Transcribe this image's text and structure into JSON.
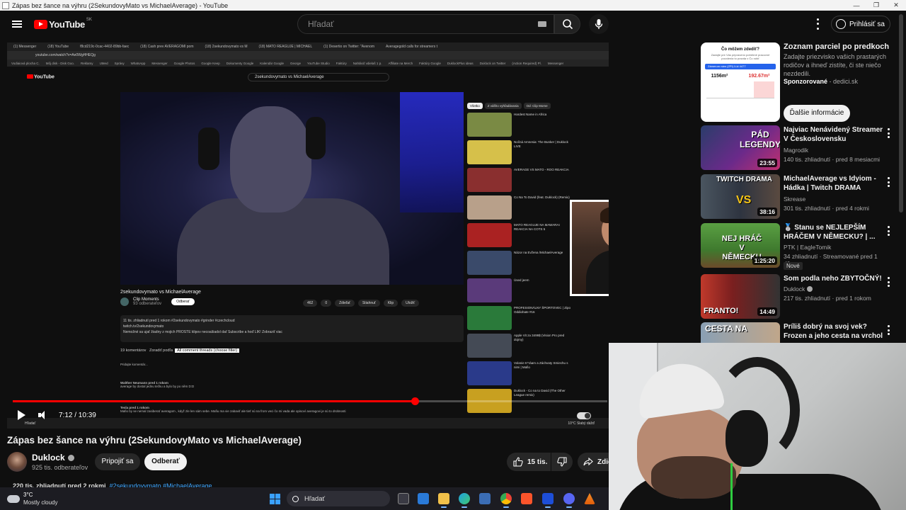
{
  "window": {
    "title": "Zápas bez šance na výhru (2SekundovyMato vs MichaelAverage) - YouTube"
  },
  "header": {
    "logo_text": "YouTube",
    "country": "SK",
    "search_placeholder": "Hľadať",
    "signin_label": "Prihlásiť sa"
  },
  "player": {
    "time": "7:12 / 10:39",
    "progress": 0.676,
    "inner": {
      "tabs": [
        "(1) Messenger",
        "(18) YouTube",
        "f8cd219c-0cac-4402-89bb-faec",
        "(18) Cash prev AVERAGOMI pom",
        "(18) 2sekundovymato vs M",
        "(18) MATO REAGUJE | MICHAEL",
        "(1) Desertio on Twitter: \"Avenom",
        "Averagegold calls for streamers t"
      ],
      "url": "youtube.com/watch?v=Ae0WgHHEQg",
      "bookmarks": [
        "Vodiaiová plocha C.",
        "Môj disk - Disk Goo.",
        "Reklamy",
        "UMed",
        "Správy",
        "WhatsApp",
        "Messenger",
        "Google Photos",
        "Google Keep",
        "Dokumenty Google",
        "Kalendár Google",
        "George",
        "YouTube Studio",
        "Faktúry",
        "Nahlásiť vdielaš 1 p.",
        "Affiliate na Merch",
        "Faktúry Google",
        "DuklockPlus ideas",
        "Duklock on Twitter",
        "(Action Required) Pl.",
        "Messenger"
      ],
      "logo": "YouTube",
      "search_value": "2sekundovymato vs MichaelAverage",
      "video_title": "2sekundovymato vs MichaelAverage",
      "channel": "Clip Moments",
      "channel_subs": "93 odberateľov",
      "subscribe": "Odberať",
      "actions": [
        "462",
        "0",
        "Zdieľať",
        "Stiahnuť",
        "Klip",
        "Uložiť"
      ],
      "desc_line1": "11 tis. zhliadnutí pred 1 rokom #2sekundovymato #grinder #czechcloud",
      "desc_line2": "twitch.tv/2sekundovymato",
      "desc_line3": "Nemožné sa ujať žiadny z mojich PROSTE klipov necoašiadol dať Subscribe a hoď LIK! Zobraziť viac",
      "comments_count": "19 komentárov",
      "sort_label": "Zoradiť podľa",
      "filter_label": "All comment threads (choose filter)",
      "add_comment": "Pridajte komentár...",
      "comment1_author": "Walther Neumann  pred 1 rokom",
      "comment1_text": "average by dostal jednu tečku a bylo by po něm D:D",
      "comment2_author": "Tesla  pred 1 rokom",
      "comment2_text": "Mafio by se nemal zasiberať averagom , když zle len sám sebe. Mafiu ma vie zabaviť ale tieť sú na from veci čo mi vada ale opisoví averagovi je sú to drobnosti",
      "taskbar_search": "Hľadať",
      "weather_inner": "10°C  Slabý dážď",
      "related_chips": [
        "Všetko",
        "Z vášho vyhľadávania",
        "Od: Clip Mome"
      ],
      "related": [
        "Hardest Name in Africa",
        "Nočná Amnesia: The Bunker | Duklock LIVE",
        "AVERAGE VS MATO - ROO REAKCIA",
        "Co Na To David (feat. Duklock) (Remix)",
        "MATO REAGUJE NA MAWARAI REAKCIA NA COTS 5",
        "Názor na Evžena /MichaelAverage",
        "Úsed jeem",
        "PROFESIONÁLNY ŠPORTOVEC | Zipo Oddiohate #16",
        "Apple Vit za 3499$ (Vision Pro pred dojmy)",
        "Volanie K*ráam a Záchvaty Smiechu s nimi | Mafio",
        "Duklock - Co na to David (The Other League remix)"
      ]
    }
  },
  "video": {
    "title": "Zápas bez šance na výhru (2SekundovyMato vs MichaelAverage)",
    "channel": "Duklock",
    "subs": "925 tis. odberateľov",
    "join": "Pripojiť sa",
    "subscribe": "Odberať",
    "likes": "15 tis.",
    "share": "Zdie",
    "desc_views": "220 tis. zhliadnutí  pred 2 rokmi",
    "desc_tags": "#2sekundovymato #MichaelAverage"
  },
  "ad": {
    "card_title": "Čo môžem zdediť?",
    "card_sub": "Zadajte pre Vás pripravenú potrebné pracovné povolenia to pravda v Čo robiť",
    "card_chip": "Zámerum nám (ZPI) Ľúč 4477",
    "card_num1": "1156m²",
    "card_num2": "192.67m²",
    "title": "Zoznam parciel po predkoch",
    "desc": "Zadajte priezvisko vašich prastarých rodičov a ihneď zistíte, či ste niečo nezdedili.",
    "sponsored": "Sponzorované",
    "domain": "dedici.sk",
    "button": "Ďalšie informácie"
  },
  "sidebar": {
    "items": [
      {
        "title": "Najviac Nenávidený Streamer V Československu",
        "channel": "Magrodik",
        "meta": "140 tis. zhliadnutí · pred 8 mesiacmi",
        "duration": "23:55",
        "thumb_text": "PÁD LEGENDY"
      },
      {
        "title": "MichaelAverage vs Idyiom - Hádka | Twitch DRAMA",
        "channel": "Skrease",
        "meta": "301 tis. zhliadnutí · pred 4 rokmi",
        "duration": "38:16",
        "thumb_text": "TWITCH DRAMA"
      },
      {
        "title": "🥈 Stanu se NEJLEPŠÍM HRÁČEM V NĚMECKU? | ...",
        "channel": "PTK | EagleTomik",
        "meta": "34 zhliadnutí · Streamované pred 1 dňom",
        "duration": "1:25:20",
        "badge": "Nové",
        "thumb_text": "NEJ HRÁČ V NĚMECKU"
      },
      {
        "title": "Som podla neho ZBYTOČNÝ!",
        "channel": "Duklock",
        "meta": "217 tis. zhliadnutí · pred 1 rokom",
        "duration": "14:49",
        "thumb_text": "FRANTO!"
      },
      {
        "title": "Príliš dobrý na svoj vek? Frozen a jeho cesta na vrchol",
        "channel": "",
        "meta": "",
        "duration": "",
        "thumb_text": "CESTA NA"
      }
    ]
  },
  "taskbar": {
    "temp": "3°C",
    "weather": "Mostly cloudy",
    "weather_sk": "Mostly cloudy",
    "search": "Hľadať"
  }
}
